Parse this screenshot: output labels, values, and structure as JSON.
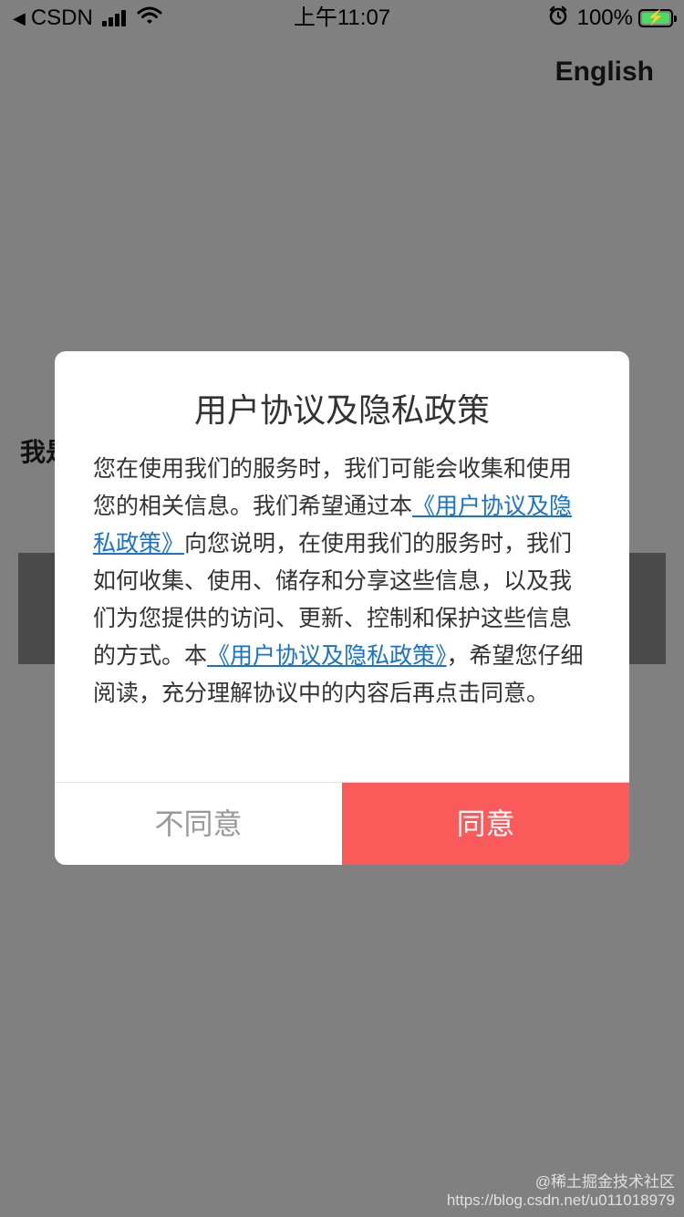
{
  "status_bar": {
    "back_arrow": "◀",
    "carrier": "CSDN",
    "time": "上午11:07",
    "battery_percent": "100%",
    "battery_level": 1.0,
    "battery_color": "#4cd964",
    "icons": [
      "back-arrow-icon",
      "signal-icon",
      "wifi-icon",
      "alarm-icon",
      "battery-icon",
      "charging-bolt-icon"
    ]
  },
  "page": {
    "language_link": "English",
    "heading_visible": "我是"
  },
  "dialog": {
    "title": "用户协议及隐私政策",
    "body": {
      "part1": "您在使用我们的服务时，我们可能会收集和使用您的相关信息。我们希望通过本",
      "link1": "《用户协议及隐私政策》",
      "part2": "向您说明，在使用我们的服务时，我们如何收集、使用、储存和分享这些信息，以及我们为您提供的访问、更新、控制和保护这些信息的方式。本",
      "link2": "《用户协议及隐私政策》",
      "part3": "，希望您仔细阅读，充分理解协议中的内容后再点击同意。"
    },
    "disagree_label": "不同意",
    "agree_label": "同意",
    "colors": {
      "link": "#1a73c8",
      "agree_bg": "#fa5a5a",
      "disagree_text": "#999999"
    }
  },
  "watermark": {
    "line1": "@稀土掘金技术社区",
    "line2": "https://blog.csdn.net/u011018979"
  }
}
